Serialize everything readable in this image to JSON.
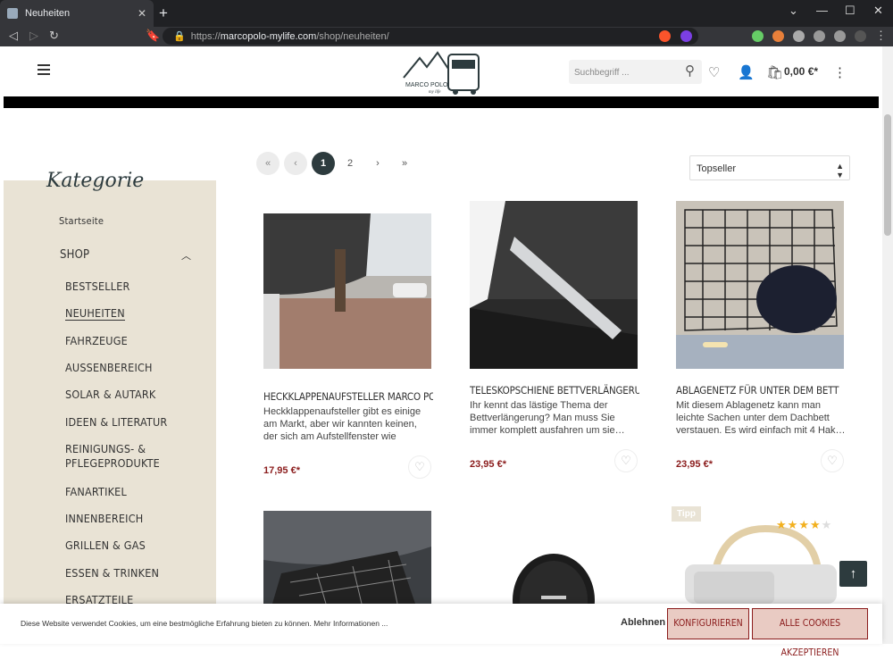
{
  "browser": {
    "tab_title": "Neuheiten",
    "url_prefix": "https://",
    "url_host": "marcopolo-mylife.com",
    "url_path": "/shop/neuheiten/"
  },
  "header": {
    "logo_text": "MARCO POLO",
    "logo_sub": "my life",
    "search_placeholder": "Suchbegriff ...",
    "cart_total": "0,00 €*"
  },
  "sidebar": {
    "title": "Kategorie",
    "home": "Startseite",
    "shop": "Shop",
    "items": [
      "Bestseller",
      "Neuheiten",
      "Fahrzeuge",
      "Aussenbereich",
      "Solar & Autark",
      "Ideen & Literatur",
      "Reinigungs- & Pflegeprodukte",
      "Fanartikel",
      "Innenbereich",
      "Grillen & Gas",
      "Essen & Trinken",
      "Ersatzteile"
    ]
  },
  "pagination": {
    "first": "«",
    "prev": "‹",
    "pages": [
      "1",
      "2"
    ],
    "next": "›",
    "last": "»",
    "current": "1"
  },
  "sort": {
    "selected": "Topseller"
  },
  "products": [
    {
      "title": "Heckklappenaufsteller Marco Polo oder",
      "desc": "Heckklappenaufsteller gibt es einige am Markt, aber wir kannten keinen, der sich am Aufstellfenster wie ander…",
      "price": "17,95 €*"
    },
    {
      "title": "Teleskopschiene Bettverlängerung",
      "desc": "Ihr kennt das lästige Thema der Bettverlängerung? Man muss Sie immer komplett ausfahren um sie…",
      "price": "23,95 €*"
    },
    {
      "title": "Ablagenetz für unter dem Bett",
      "desc": "Mit diesem Ablagenetz kann man leichte Sachen unter dem Dachbett verstauen. Es wird einfach mit 4 Hak…",
      "price": "23,95 €*"
    }
  ],
  "badges": {
    "tipp": "Tipp",
    "rating": 4
  },
  "cookie": {
    "text": "Diese Website verwendet Cookies, um eine bestmögliche Erfahrung bieten zu können. Mehr Informationen ...",
    "reject": "Ablehnen",
    "configure": "Konfigurieren",
    "accept": "Alle Cookies akzeptieren"
  },
  "colors": {
    "accent": "#2d3b3e",
    "price": "#8b1c1c",
    "sidebar_bg": "#e9e3d5"
  }
}
